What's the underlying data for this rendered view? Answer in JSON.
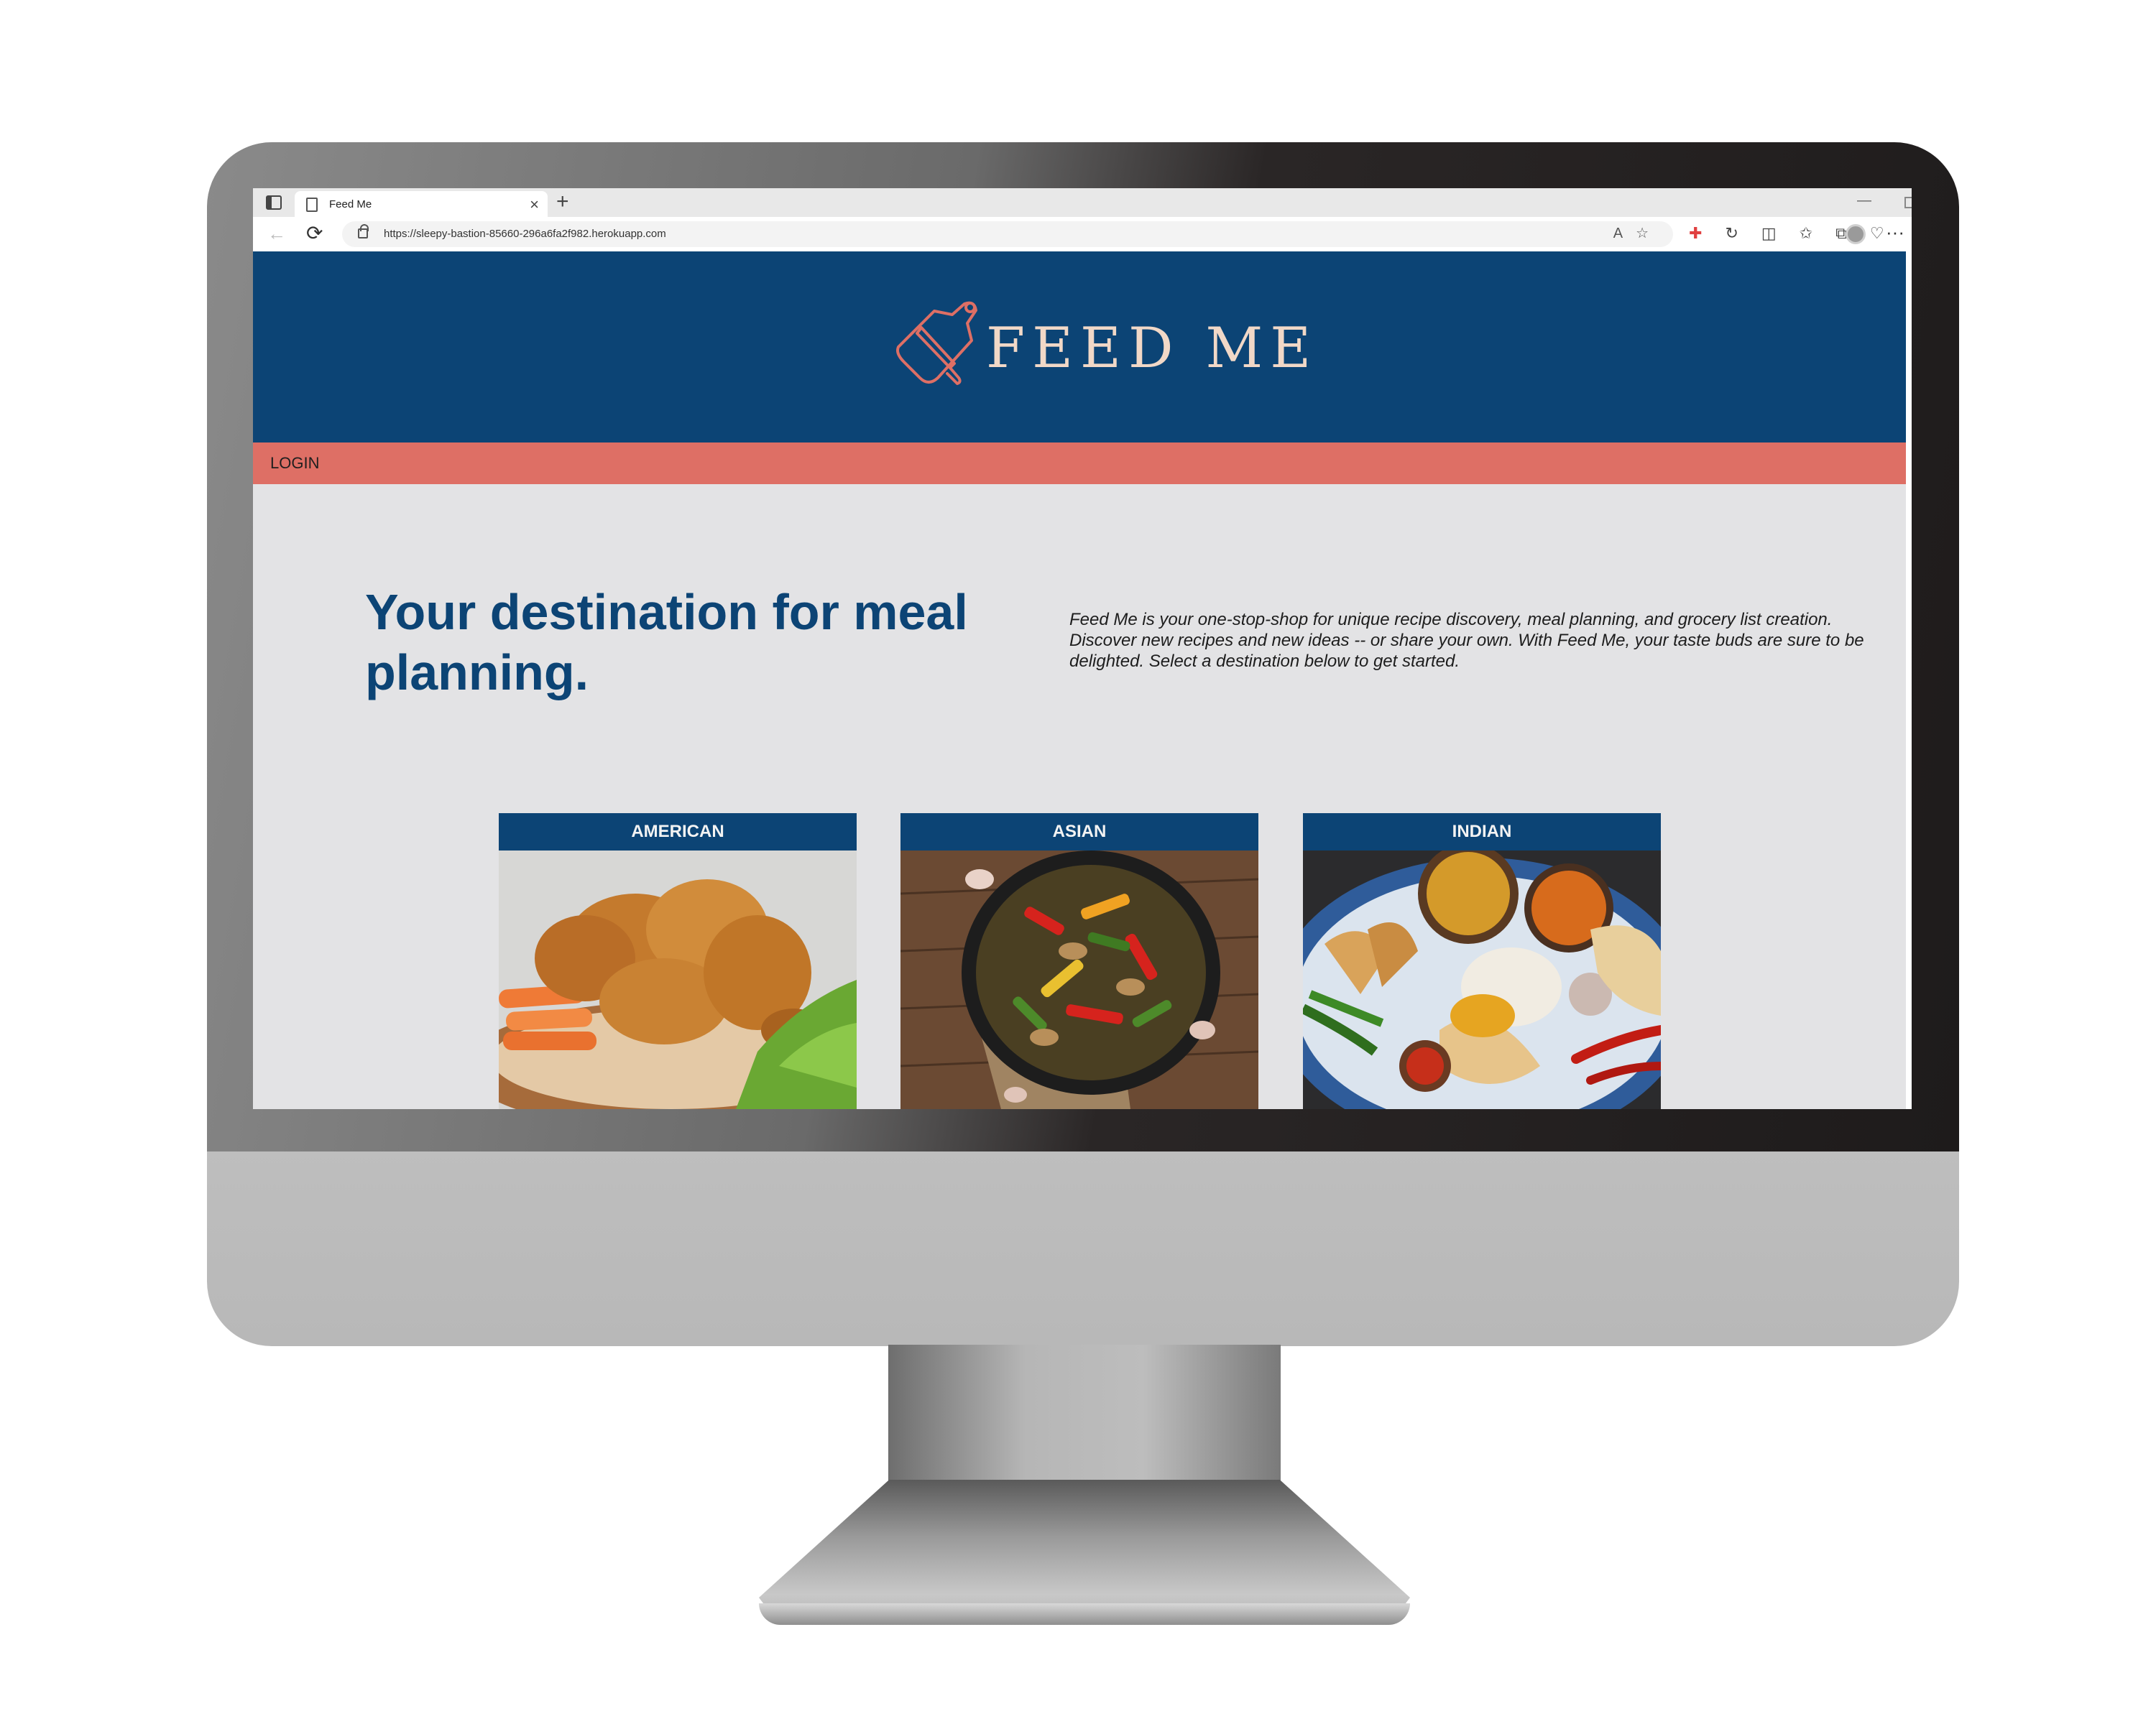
{
  "browser": {
    "tab_title": "Feed Me",
    "tab_close": "×",
    "new_tab": "+",
    "url": "https://sleepy-bastion-85660-296a6fa2f982.herokuapp.com",
    "back": "←",
    "reload": "⟳",
    "minimize": "—",
    "read_aloud": "A",
    "favorite": "☆",
    "more": "···"
  },
  "site": {
    "logo_text": "FEED ME",
    "nav": {
      "login": "LOGIN"
    },
    "hero": {
      "title": "Your destination for meal planning.",
      "description": "Feed Me is your one-stop-shop for unique recipe discovery, meal planning, and grocery list creation. Discover new recipes and new ideas -- or share your own. With Feed Me, your taste buds are sure to be delighted. Select a destination below to get started."
    },
    "cards": [
      {
        "title": "AMERICAN",
        "image": "fried-chicken-photo"
      },
      {
        "title": "ASIAN",
        "image": "stir-fry-pan-photo"
      },
      {
        "title": "INDIAN",
        "image": "indian-thali-photo"
      }
    ]
  },
  "colors": {
    "header_blue": "#0c4475",
    "nav_coral": "#de6f65",
    "logo_peach": "#f1d8c7",
    "page_bg": "#e3e3e5"
  }
}
